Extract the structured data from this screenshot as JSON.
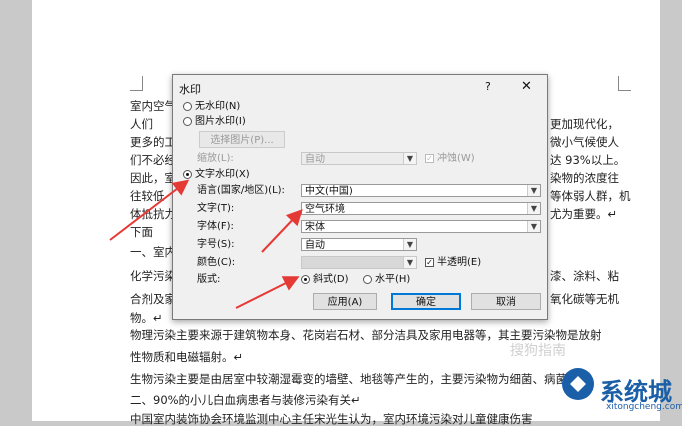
{
  "document": {
    "lines": [
      {
        "left": "室内空气",
        "right": ""
      },
      {
        "left": "    人们",
        "right": "更加现代化，"
      },
      {
        "left": "更多的工",
        "right": "微小气候使人"
      },
      {
        "left": "们不必经",
        "right": "达 93%以上。"
      },
      {
        "left": "因此，室",
        "right": "染物的浓度往"
      },
      {
        "left": "往较低",
        "right": "等体弱人群，机"
      },
      {
        "left": "体抵抗力",
        "right": "尤为重要。↵"
      },
      {
        "left": "    下面",
        "right": ""
      },
      {
        "left": "一、室内",
        "right": ""
      },
      {
        "left": "化学污染",
        "right": "漆、涂料、粘"
      },
      {
        "left": "合剂及家",
        "right": "氧化碳等无机"
      },
      {
        "left": "物。↵",
        "right": ""
      },
      {
        "left": "物理污染主要来源于建筑物本身、花岗岩石材、部分洁具及家用电器等，其主要污染物是放射",
        "right": ""
      },
      {
        "left": "性物质和电磁辐射。↵",
        "right": ""
      },
      {
        "left": "生物污染主要是由居室中较潮湿霉变的墙壁、地毯等产生的，主要污染物为细菌、病菌",
        "right": ""
      },
      {
        "left": "二、90%的小儿白血病患者与装修污染有关↵",
        "right": ""
      },
      {
        "left": "    中国室内装饰协会环境监测中心主任宋光生认为，室内环境污染对儿童健康伤害",
        "right": ""
      }
    ]
  },
  "dialog": {
    "title": "水印",
    "help": "?",
    "close": "✕",
    "no_watermark": "无水印(N)",
    "picture_watermark": "图片水印(I)",
    "select_picture": "选择图片(P)...",
    "scale_label": "缩放(L):",
    "scale_value": "自动",
    "washout": "冲蚀(W)",
    "text_watermark": "文字水印(X)",
    "language_label": "语言(国家/地区)(L):",
    "language_value": "中文(中国)",
    "text_label": "文字(T):",
    "text_value": "空气环境",
    "font_label": "字体(F):",
    "font_value": "宋体",
    "size_label": "字号(S):",
    "size_value": "自动",
    "color_label": "颜色(C):",
    "semitransparent": "半透明(E)",
    "layout_label": "版式:",
    "diagonal": "斜式(D)",
    "horizontal": "水平(H)",
    "apply": "应用(A)",
    "ok": "确定",
    "cancel": "取消"
  },
  "watermark_site": {
    "name": "系统城",
    "url": "xitongcheng.com",
    "faint": "搜狗指南"
  },
  "colors": {
    "arrow": "#e53935",
    "primary_border": "#0078d7",
    "brand": "#1b5fa8"
  },
  "icons": [
    "radio-icon",
    "checkbox-icon",
    "dropdown-arrow-icon",
    "close-icon",
    "help-icon",
    "arrow-annotation-icon",
    "site-logo-icon"
  ]
}
